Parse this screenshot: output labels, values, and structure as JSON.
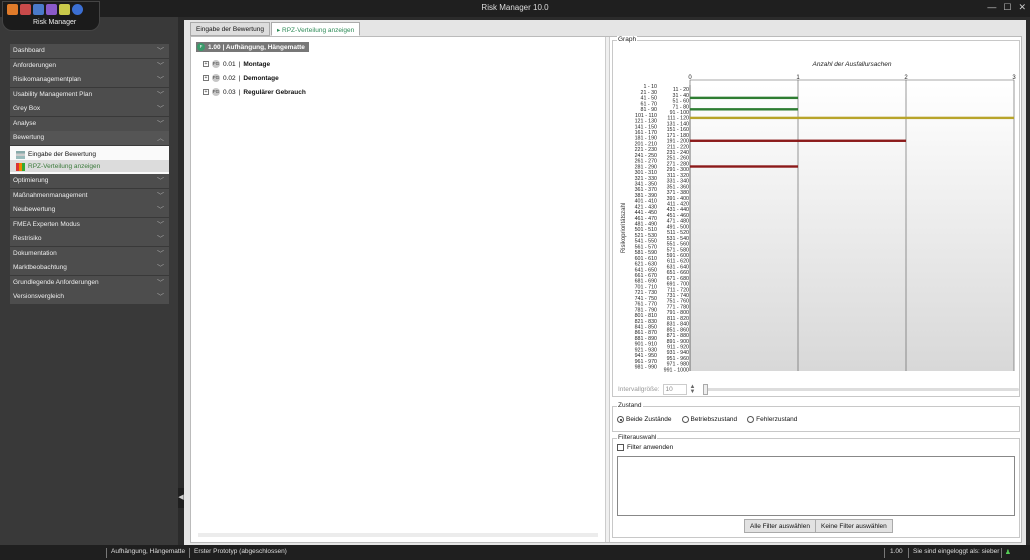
{
  "window": {
    "title": "Risk Manager   10.0",
    "controls": [
      "—",
      "☐",
      "✕"
    ]
  },
  "app": {
    "name": "Risk Manager"
  },
  "sidebar": {
    "items": [
      {
        "label": "Dashboard"
      },
      {
        "label": "Anforderungen"
      },
      {
        "label": "Risikomanagementplan"
      },
      {
        "label": "Usability Management Plan"
      },
      {
        "label": "Grey Box"
      },
      {
        "label": "Analyse"
      },
      {
        "label": "Bewertung",
        "expanded": true,
        "children": [
          {
            "label": "Eingabe der Bewertung"
          },
          {
            "label": "RPZ-Verteilung anzeigen",
            "selected": true
          }
        ]
      },
      {
        "label": "Optimierung"
      },
      {
        "label": "Maßnahmenmanagement"
      },
      {
        "label": "Neubewertung"
      },
      {
        "label": "FMEA Experten Modus"
      },
      {
        "label": "Restrisiko"
      },
      {
        "label": "Dokumentation"
      },
      {
        "label": "Marktbeobachtung"
      },
      {
        "label": "Grundlegende Anforderungen"
      },
      {
        "label": "Versionsvergleich"
      }
    ]
  },
  "tabs": [
    {
      "label": "Eingabe der Bewertung"
    },
    {
      "label": "RPZ-Verteilung anzeigen",
      "active": true
    }
  ],
  "tree": {
    "root": {
      "badge": "F",
      "label": "1.00  |  Aufhängung, Hängematte"
    },
    "children": [
      {
        "badge": "FG",
        "id": "0.01",
        "label": "Montage"
      },
      {
        "badge": "FG",
        "id": "0.02",
        "label": "Demontage"
      },
      {
        "badge": "FG",
        "id": "0.03",
        "label": "Regulärer Gebrauch"
      }
    ]
  },
  "graph": {
    "group_label": "Graph",
    "interval_label": "Intervallgröße:",
    "interval_value": "10"
  },
  "chart_data": {
    "type": "bar",
    "orientation": "horizontal",
    "title": "Anzahl der Ausfallursachen",
    "ylabel": "Risikoprioritätszahl",
    "xlim": [
      0,
      3
    ],
    "x_ticks": [
      "0",
      "1",
      "2",
      "3"
    ],
    "categories": [
      "1 - 10",
      "11 - 20",
      "21 - 30",
      "31 - 40",
      "41 - 50",
      "51 - 60",
      "61 - 70",
      "71 - 80",
      "81 - 90",
      "91 - 100",
      "101 - 110",
      "111 - 120",
      "121 - 130",
      "131 - 140",
      "141 - 150",
      "151 - 160",
      "161 - 170",
      "171 - 180",
      "181 - 190",
      "191 - 200",
      "201 - 210",
      "211 - 220",
      "221 - 230",
      "231 - 240",
      "241 - 250",
      "251 - 260",
      "261 - 270",
      "271 - 280",
      "281 - 290",
      "291 - 300",
      "301 - 310",
      "311 - 320",
      "321 - 330",
      "331 - 340",
      "341 - 350",
      "351 - 360",
      "361 - 370",
      "371 - 380",
      "381 - 390",
      "391 - 400",
      "401 - 410",
      "411 - 420",
      "421 - 430",
      "431 - 440",
      "441 - 450",
      "451 - 460",
      "461 - 470",
      "471 - 480",
      "481 - 490",
      "491 - 500",
      "501 - 510",
      "511 - 520",
      "521 - 530",
      "531 - 540",
      "541 - 550",
      "551 - 560",
      "561 - 570",
      "571 - 580",
      "581 - 590",
      "591 - 600",
      "601 - 610",
      "611 - 620",
      "621 - 630",
      "631 - 640",
      "641 - 650",
      "651 - 660",
      "661 - 670",
      "671 - 680",
      "681 - 690",
      "691 - 700",
      "701 - 710",
      "711 - 720",
      "721 - 730",
      "731 - 740",
      "741 - 750",
      "751 - 760",
      "761 - 770",
      "771 - 780",
      "781 - 790",
      "791 - 800",
      "801 - 810",
      "811 - 820",
      "821 - 830",
      "831 - 840",
      "841 - 850",
      "851 - 860",
      "861 - 870",
      "871 - 880",
      "881 - 890",
      "891 - 900",
      "901 - 910",
      "911 - 920",
      "921 - 930",
      "931 - 940",
      "941 - 950",
      "951 - 960",
      "961 - 970",
      "971 - 980",
      "981 - 990",
      "991 - 1000"
    ],
    "bars": [
      {
        "category": "41 - 50",
        "value": 1,
        "color": "#2e7d32"
      },
      {
        "category": "81 - 90",
        "value": 1,
        "color": "#2e7d32"
      },
      {
        "category": "111 - 120",
        "value": 3,
        "color": "#b8a42a"
      },
      {
        "category": "191 - 200",
        "value": 2,
        "color": "#8b1a1a"
      },
      {
        "category": "281 - 290",
        "value": 1,
        "color": "#8b1a1a"
      }
    ],
    "grid": true
  },
  "zustand": {
    "group_label": "Zustand",
    "options": [
      {
        "label": "Beide Zustände",
        "checked": true
      },
      {
        "label": "Betriebszustand",
        "checked": false
      },
      {
        "label": "Fehlerzustand",
        "checked": false
      }
    ]
  },
  "filter": {
    "group_label": "Filterauswahl",
    "checkbox_label": "Filter anwenden",
    "select_all_label": "Alle Filter auswählen",
    "select_none_label": "Keine Filter auswählen"
  },
  "statusbar": {
    "node": "Aufhängung, Hängematte",
    "phase": "Erster Prototyp (abgeschlossen)",
    "value": "1.00",
    "login": "Sie sind eingeloggt als: sieber"
  },
  "colors": {
    "accent": "#3a9a6a",
    "selected_text": "#2e8b57"
  }
}
